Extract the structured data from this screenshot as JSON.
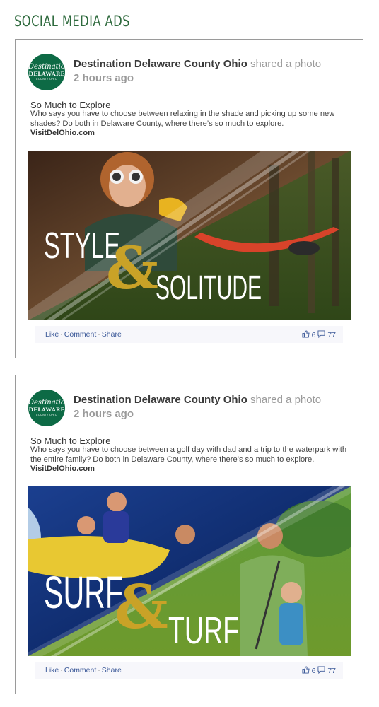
{
  "page": {
    "section_title": "SOCIAL MEDIA ADS"
  },
  "posts": [
    {
      "logo": {
        "line1": "Destination",
        "line2": "DELAWARE",
        "line3": "COUNTY OHIO"
      },
      "org": "Destination Delaware County Ohio",
      "action": "shared a photo",
      "time": "2 hours ago",
      "headline": "So Much to Explore",
      "body": "Who says you have to choose between relaxing in the shade and picking up some new shades? Do both in Delaware County, where there’s so much to explore.",
      "link": "VisitDelOhio.com",
      "ad": {
        "word1": "STYLE",
        "amp": "&",
        "word2": "SOLITUDE"
      },
      "footer": {
        "like": "Like",
        "comment": "Comment",
        "share": "Share",
        "likes": "6",
        "comments": "77"
      }
    },
    {
      "logo": {
        "line1": "Destination",
        "line2": "DELAWARE",
        "line3": "COUNTY OHIO"
      },
      "org": "Destination Delaware County Ohio",
      "action": "shared a photo",
      "time": "2 hours ago",
      "headline": "So Much to Explore",
      "body": "Who says you have to choose between a golf day with dad and a trip to the waterpark with the entire family? Do both in Delaware County, where there’s so much to explore.",
      "link": "VisitDelOhio.com",
      "ad": {
        "word1": "SURF",
        "amp": "&",
        "word2": "TURF"
      },
      "footer": {
        "like": "Like",
        "comment": "Comment",
        "share": "Share",
        "likes": "6",
        "comments": "77"
      }
    }
  ],
  "colors": {
    "brand_green": "#0d6a45",
    "title_green": "#2e6a3d",
    "link_blue": "#3d5a99",
    "ampersand_gold": "#c9a227"
  }
}
